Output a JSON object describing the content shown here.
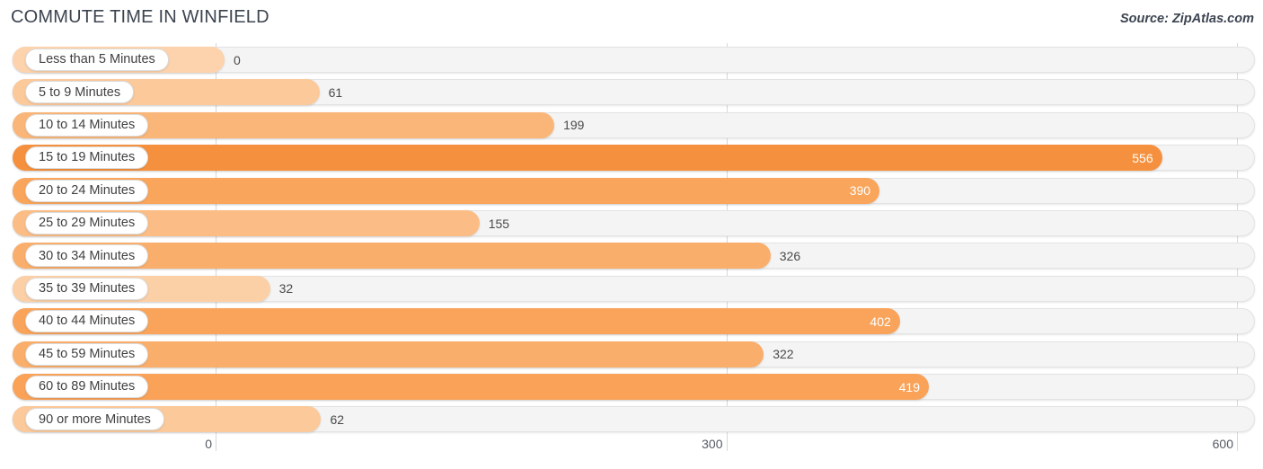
{
  "header": {
    "title": "COMMUTE TIME IN WINFIELD",
    "source": "Source: ZipAtlas.com"
  },
  "colors": {
    "bar_high": "#F5913E",
    "bar_mid_high": "#F9A55C",
    "bar_mid": "#FAAE6B",
    "bar_low": "#FBC99A",
    "bar_lowest": "#FCD3AC",
    "track": "#f4f4f4",
    "gridline": "#d8d8d8",
    "text": "#3c4450"
  },
  "axis": {
    "ticks": [
      {
        "label": "0",
        "value": 0
      },
      {
        "label": "300",
        "value": 300
      },
      {
        "label": "600",
        "value": 600
      }
    ],
    "min": 0,
    "max": 600
  },
  "chart_data": {
    "type": "bar",
    "orientation": "horizontal",
    "title": "COMMUTE TIME IN WINFIELD",
    "subtitle": "",
    "xlabel": "",
    "ylabel": "",
    "xlim": [
      0,
      600
    ],
    "grid": true,
    "legend": false,
    "source": "Source: ZipAtlas.com",
    "categories": [
      "Less than 5 Minutes",
      "5 to 9 Minutes",
      "10 to 14 Minutes",
      "15 to 19 Minutes",
      "20 to 24 Minutes",
      "25 to 29 Minutes",
      "30 to 34 Minutes",
      "35 to 39 Minutes",
      "40 to 44 Minutes",
      "45 to 59 Minutes",
      "60 to 89 Minutes",
      "90 or more Minutes"
    ],
    "values": [
      0,
      61,
      199,
      556,
      390,
      155,
      326,
      32,
      402,
      322,
      419,
      62
    ],
    "value_labels": [
      "0",
      "61",
      "199",
      "556",
      "390",
      "155",
      "326",
      "32",
      "402",
      "322",
      "419",
      "62"
    ]
  },
  "rows": [
    {
      "label": "Less than 5 Minutes",
      "value": 0,
      "value_label": "0",
      "color": "#FCD3AC",
      "label_inside": false
    },
    {
      "label": "5 to 9 Minutes",
      "value": 61,
      "value_label": "61",
      "color": "#FBC99A",
      "label_inside": false
    },
    {
      "label": "10 to 14 Minutes",
      "value": 199,
      "value_label": "199",
      "color": "#FAB678",
      "label_inside": false
    },
    {
      "label": "15 to 19 Minutes",
      "value": 556,
      "value_label": "556",
      "color": "#F5913E",
      "label_inside": true
    },
    {
      "label": "20 to 24 Minutes",
      "value": 390,
      "value_label": "390",
      "color": "#F9A55C",
      "label_inside": true
    },
    {
      "label": "25 to 29 Minutes",
      "value": 155,
      "value_label": "155",
      "color": "#FBBD85",
      "label_inside": false
    },
    {
      "label": "30 to 34 Minutes",
      "value": 326,
      "value_label": "326",
      "color": "#FAAE6B",
      "label_inside": false
    },
    {
      "label": "35 to 39 Minutes",
      "value": 32,
      "value_label": "32",
      "color": "#FCD0A6",
      "label_inside": false
    },
    {
      "label": "40 to 44 Minutes",
      "value": 402,
      "value_label": "402",
      "color": "#F9A45A",
      "label_inside": true
    },
    {
      "label": "45 to 59 Minutes",
      "value": 322,
      "value_label": "322",
      "color": "#FAAE6B",
      "label_inside": false
    },
    {
      "label": "60 to 89 Minutes",
      "value": 419,
      "value_label": "419",
      "color": "#F9A258",
      "label_inside": true
    },
    {
      "label": "90 or more Minutes",
      "value": 62,
      "value_label": "62",
      "color": "#FBC99A",
      "label_inside": false
    }
  ]
}
